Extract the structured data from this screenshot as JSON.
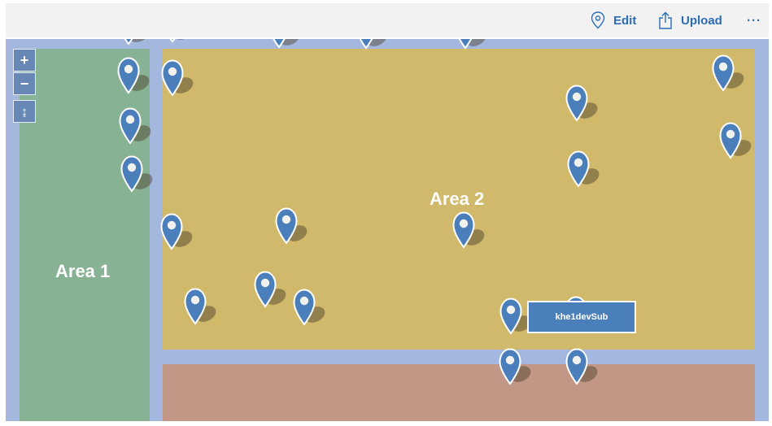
{
  "toolbar": {
    "edit_label": "Edit",
    "upload_label": "Upload",
    "more_label": "···"
  },
  "map": {
    "zoom_in_label": "+",
    "zoom_out_label": "−",
    "fit_label": "↨",
    "areas": [
      {
        "label": "Area 1",
        "color": "#88b294"
      },
      {
        "label": "Area 2",
        "color": "#d0b96b"
      },
      {
        "label": "",
        "color": "#c39786"
      }
    ],
    "background_color": "#a4b8df",
    "pin_color": "#4a7fbc",
    "tooltip_label": "khe1devSub"
  }
}
